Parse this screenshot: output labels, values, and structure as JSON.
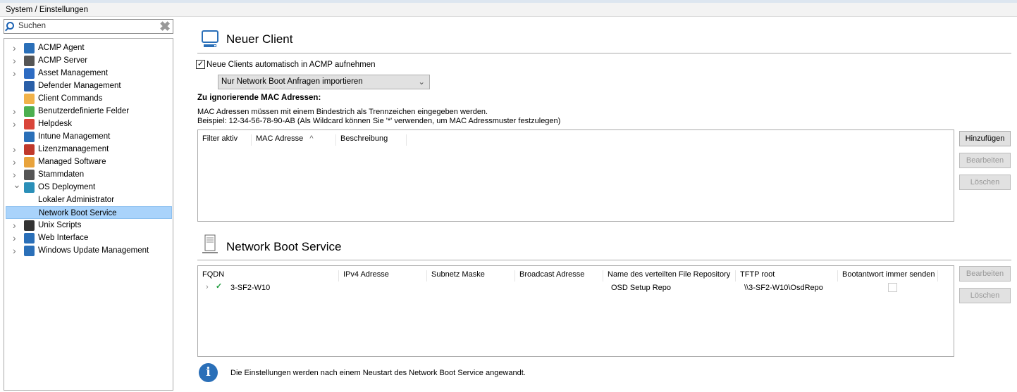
{
  "breadcrumb": "System / Einstellungen",
  "search": {
    "placeholder": "Suchen"
  },
  "tree": [
    {
      "label": "ACMP Agent",
      "expander": true,
      "color": "#2a6fb8"
    },
    {
      "label": "ACMP Server",
      "expander": true,
      "color": "#555"
    },
    {
      "label": "Asset Management",
      "expander": true,
      "color": "#2d6bc2"
    },
    {
      "label": "Defender Management",
      "expander": false,
      "color": "#2a5fa8"
    },
    {
      "label": "Client Commands",
      "expander": false,
      "color": "#f1b24a"
    },
    {
      "label": "Benutzerdefinierte Felder",
      "expander": true,
      "color": "#4caf50"
    },
    {
      "label": "Helpdesk",
      "expander": true,
      "color": "#d9453a"
    },
    {
      "label": "Intune Management",
      "expander": false,
      "color": "#2a6fb8"
    },
    {
      "label": "Lizenzmanagement",
      "expander": true,
      "color": "#c0392b"
    },
    {
      "label": "Managed Software",
      "expander": true,
      "color": "#e8a33c"
    },
    {
      "label": "Stammdaten",
      "expander": true,
      "color": "#555"
    },
    {
      "label": "OS Deployment",
      "expander": "open",
      "color": "#2a8fb8"
    },
    {
      "label": "Lokaler Administrator",
      "child": true
    },
    {
      "label": "Network Boot Service",
      "child": true,
      "selected": true
    },
    {
      "label": "Unix Scripts",
      "expander": true,
      "color": "#333"
    },
    {
      "label": "Web Interface",
      "expander": true,
      "color": "#2a6fb8"
    },
    {
      "label": "Windows Update Management",
      "expander": true,
      "color": "#2a6fb8"
    }
  ],
  "neuer_client": {
    "title": "Neuer Client",
    "auto_checkbox_label": "Neue Clients automatisch in ACMP aufnehmen",
    "auto_checked": true,
    "import_select": "Nur Network Boot Anfragen importieren",
    "mac_heading": "Zu ignorierende MAC Adressen:",
    "mac_info1": "MAC Adressen müssen mit einem Bindestrich als Trennzeichen eingegeben werden.",
    "mac_info2": "Beispiel: 12-34-56-78-90-AB (Als Wildcard können Sie '*' verwenden, um MAC Adressmuster festzulegen)",
    "columns": [
      "Filter aktiv",
      "MAC Adresse",
      "Beschreibung"
    ],
    "sort_indicator": "^",
    "buttons": {
      "add": "Hinzufügen",
      "edit": "Bearbeiten",
      "delete": "Löschen"
    }
  },
  "nbs": {
    "title": "Network Boot Service",
    "columns": [
      "FQDN",
      "IPv4 Adresse",
      "Subnetz Maske",
      "Broadcast Adresse",
      "Name des verteilten File Repository",
      "TFTP root",
      "Bootantwort immer senden"
    ],
    "rows": [
      {
        "fqdn": "3-SF2-W10",
        "ipv4": "",
        "subnet": "",
        "broadcast": "",
        "repo": "OSD Setup Repo",
        "tftp": "\\\\3-SF2-W10\\OsdRepo",
        "always": false
      }
    ],
    "buttons": {
      "edit": "Bearbeiten",
      "delete": "Löschen"
    },
    "info": "Die Einstellungen werden nach einem Neustart des Network Boot Service angewandt."
  }
}
